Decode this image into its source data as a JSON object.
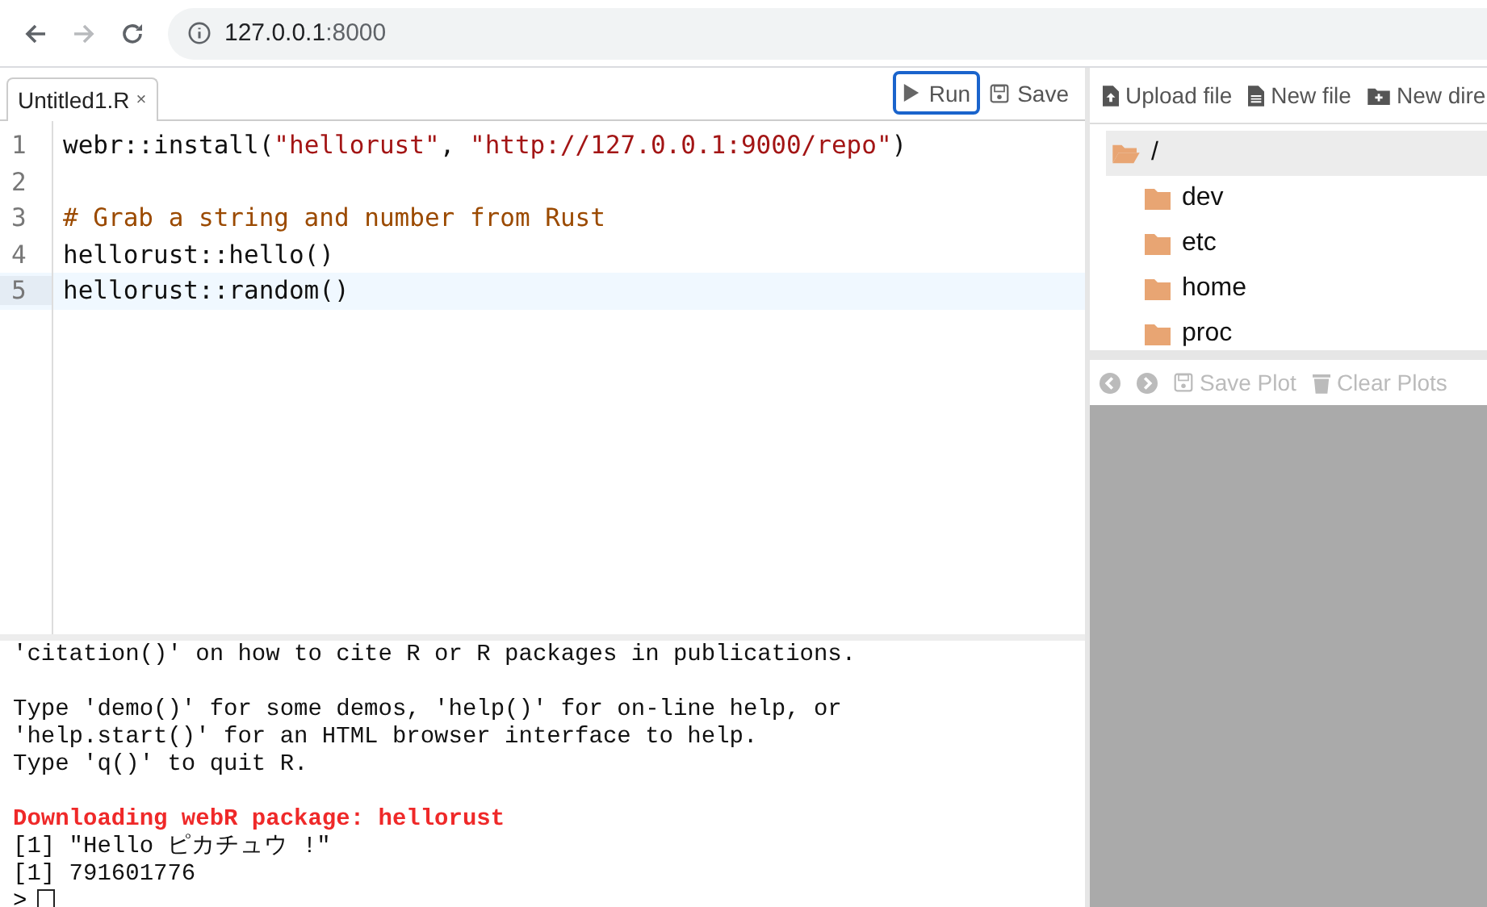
{
  "browser": {
    "url_host": "127.0.0.1",
    "url_port": ":8000"
  },
  "editor": {
    "tabs": [
      {
        "label": "Untitled1.R",
        "close": "×",
        "selected": true
      }
    ],
    "buttons": [
      {
        "label": "Run",
        "kind": "run",
        "focused": true
      },
      {
        "label": "Save",
        "kind": "save",
        "focused": false
      }
    ],
    "lines": [
      {
        "number": "1",
        "active": false,
        "tokens": [
          {
            "kind": "plain",
            "text": "webr::install("
          },
          {
            "kind": "string",
            "text": "\"hellorust\""
          },
          {
            "kind": "plain",
            "text": ", "
          },
          {
            "kind": "string",
            "text": "\"http://127.0.0.1:9000/repo\""
          },
          {
            "kind": "plain",
            "text": ")"
          }
        ]
      },
      {
        "number": "2",
        "active": false
      },
      {
        "number": "3",
        "active": false,
        "tokens": [
          {
            "kind": "comment",
            "text": "# Grab a string and number from Rust"
          }
        ]
      },
      {
        "number": "4",
        "active": false,
        "tokens": [
          {
            "kind": "plain",
            "text": "hellorust::hello()"
          }
        ]
      },
      {
        "number": "5",
        "active": true,
        "tokens": [
          {
            "kind": "plain",
            "text": "hellorust::random()"
          }
        ]
      }
    ]
  },
  "console": {
    "blocks": [
      {
        "lines": [
          {
            "kind": "normal",
            "text": "'citation()' on how to cite R or R packages in publications."
          }
        ]
      },
      {
        "lines": [
          {
            "kind": "normal",
            "text": "Type 'demo()' for some demos, 'help()' for on-line help, or"
          },
          {
            "kind": "normal",
            "text": "'help.start()' for an HTML browser interface to help."
          },
          {
            "kind": "normal",
            "text": "Type 'q()' to quit R."
          }
        ]
      },
      {
        "lines": [
          {
            "kind": "error",
            "text": "Downloading webR package: hellorust"
          },
          {
            "kind": "normal",
            "text": "[1] \"Hello ピカチュウ !\""
          },
          {
            "kind": "normal",
            "text": "[1] 791601776"
          }
        ]
      }
    ],
    "prompt": ">"
  },
  "files": {
    "toolbar": [
      {
        "label": "Upload file",
        "kind": "upload"
      },
      {
        "label": "New file",
        "kind": "file"
      },
      {
        "label": "New dire",
        "kind": "folder"
      }
    ],
    "tree": [
      {
        "name": "/",
        "selected": true,
        "expanded": true,
        "children": [
          {
            "name": "dev",
            "selected": false
          },
          {
            "name": "etc",
            "selected": false
          },
          {
            "name": "home",
            "selected": false
          },
          {
            "name": "proc",
            "selected": false
          }
        ]
      }
    ]
  },
  "plots": {
    "toolbar": [
      {
        "kind": "back"
      },
      {
        "kind": "forward"
      },
      {
        "label": "Save Plot",
        "kind": "save"
      },
      {
        "label": "Clear Plots",
        "kind": "trash"
      }
    ]
  }
}
